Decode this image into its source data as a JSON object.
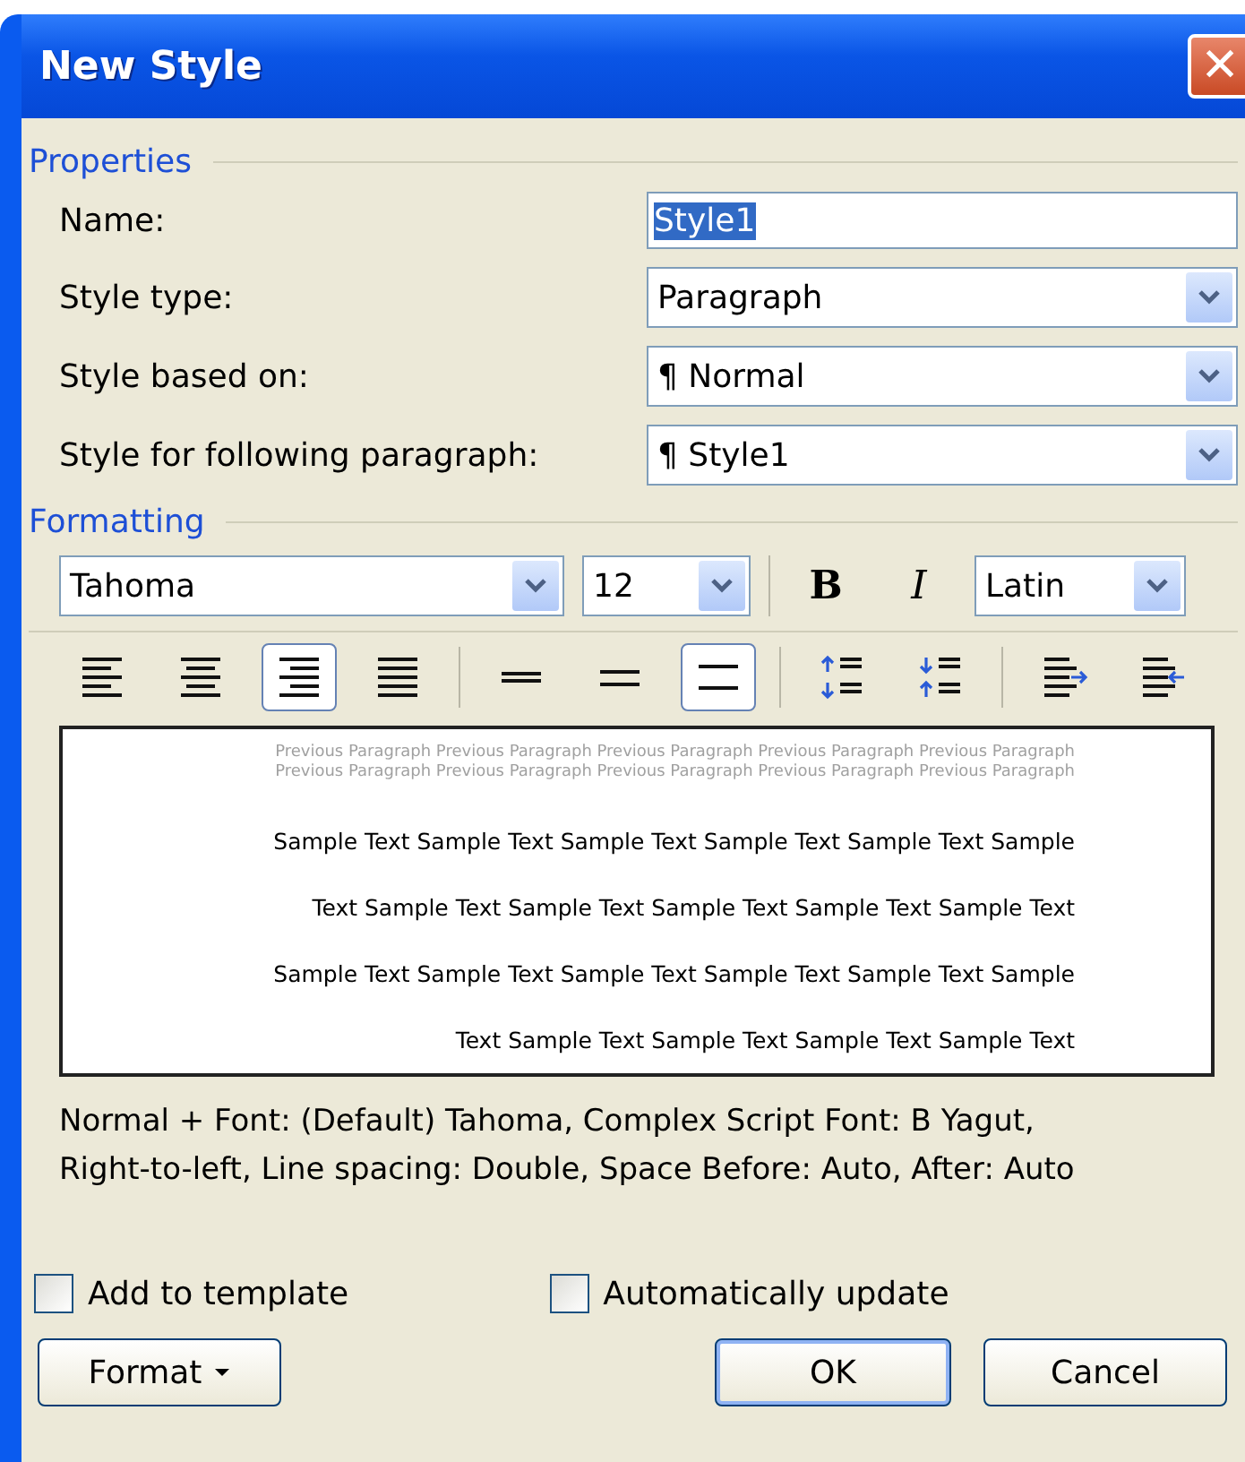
{
  "window": {
    "title": "New Style",
    "close_label": "✕"
  },
  "properties": {
    "legend": "Properties",
    "name": {
      "label": "Name:",
      "value": "Style1",
      "selected_text": true
    },
    "dropdowns": [
      {
        "label": "Style type:",
        "value": "Paragraph"
      },
      {
        "label": "Style based on:",
        "value": "¶ Normal"
      },
      {
        "label": "Style for following paragraph:",
        "value": "¶ Style1"
      }
    ]
  },
  "formatting": {
    "legend": "Formatting",
    "font": "Tahoma",
    "size": "12",
    "bold": {
      "label": "B",
      "selected": false
    },
    "italic": {
      "label": "I",
      "selected": false
    },
    "script": "Latin",
    "buttons": [
      {
        "kind": "align-left",
        "selected": false
      },
      {
        "kind": "align-center",
        "selected": false
      },
      {
        "kind": "align-right",
        "selected": true
      },
      {
        "kind": "justify",
        "selected": false
      },
      {
        "kind": "single",
        "selected": false
      },
      {
        "kind": "one-half",
        "selected": false
      },
      {
        "kind": "double",
        "selected": true
      },
      {
        "kind": "space-increase",
        "selected": false
      },
      {
        "kind": "space-decrease",
        "selected": false
      },
      {
        "kind": "indent-increase",
        "selected": false
      },
      {
        "kind": "indent-decrease",
        "selected": false
      }
    ],
    "preview": {
      "previous": [
        "Previous Paragraph Previous Paragraph Previous Paragraph Previous Paragraph Previous Paragraph",
        "Previous Paragraph Previous Paragraph Previous Paragraph Previous Paragraph Previous Paragraph"
      ],
      "sample": [
        "Sample Text Sample Text Sample Text Sample Text Sample Text Sample",
        "Text Sample Text Sample Text Sample Text Sample Text Sample Text",
        "Sample Text Sample Text Sample Text Sample Text Sample Text Sample",
        "Text Sample Text Sample Text Sample Text Sample Text"
      ]
    },
    "description": [
      "Normal + Font: (Default) Tahoma, Complex Script Font: B Yagut,",
      "Right-to-left, Line spacing:  Double, Space Before:  Auto, After:  Auto"
    ]
  },
  "options": [
    {
      "label": "Add to template",
      "checked": false
    },
    {
      "label": "Automatically update",
      "checked": false
    }
  ],
  "buttons": [
    {
      "label": "Format",
      "kind": "menu"
    },
    {
      "label": "OK",
      "kind": "default"
    },
    {
      "label": "Cancel",
      "kind": "normal"
    }
  ]
}
